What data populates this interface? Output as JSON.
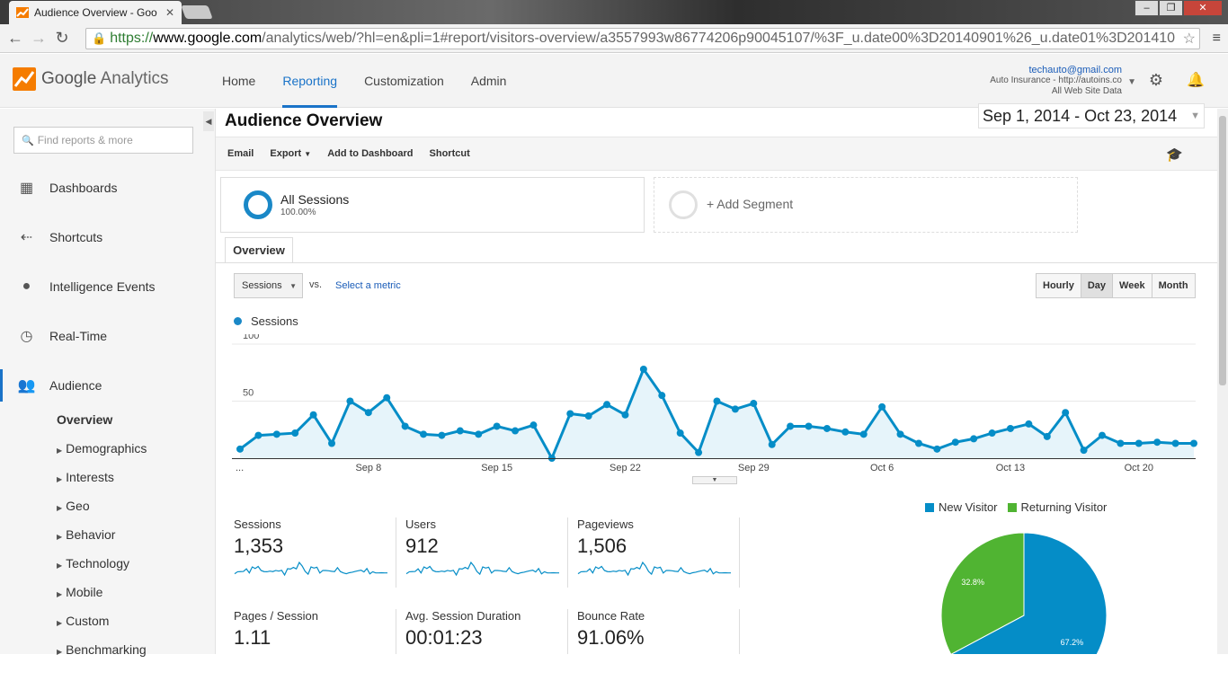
{
  "browser": {
    "tab_title": "Audience Overview - Goo",
    "tab_close": "✕",
    "url_https": "https://",
    "url_domain": "www.google.com",
    "url_path": "/analytics/web/?hl=en&pli=1#report/visitors-overview/a3557993w86774206p90045107/%3F_u.date00%3D20140901%26_u.date01%3D201410",
    "window_buttons": [
      "–",
      "❐",
      "✕"
    ]
  },
  "header": {
    "logo_google": "Google",
    "logo_analytics": "Analytics",
    "nav": [
      "Home",
      "Reporting",
      "Customization",
      "Admin"
    ],
    "active_nav": "Reporting",
    "account_email": "techauto@gmail.com",
    "account_property": "Auto Insurance - http://autoins.co",
    "account_view": "All Web Site Data"
  },
  "sidebar": {
    "search_placeholder": "Find reports & more",
    "items": [
      {
        "label": "Dashboards",
        "icon": "grid-icon"
      },
      {
        "label": "Shortcuts",
        "icon": "arrows-icon"
      },
      {
        "label": "Intelligence Events",
        "icon": "bulb-icon"
      },
      {
        "label": "Real-Time",
        "icon": "clock-icon"
      },
      {
        "label": "Audience",
        "icon": "people-icon"
      }
    ],
    "subitems": [
      "Overview",
      "Demographics",
      "Interests",
      "Geo",
      "Behavior",
      "Technology",
      "Mobile",
      "Custom",
      "Benchmarking"
    ]
  },
  "main": {
    "title": "Audience Overview",
    "date_range": "Sep 1, 2014 - Oct 23, 2014",
    "toolbar": [
      "Email",
      "Export",
      "Add to Dashboard",
      "Shortcut"
    ],
    "segment_name": "All Sessions",
    "segment_pct": "100.00%",
    "add_segment": "+ Add Segment",
    "tab": "Overview",
    "metric_select": "Sessions",
    "vs": "vs.",
    "select_metric": "Select a metric",
    "granularity": [
      "Hourly",
      "Day",
      "Week",
      "Month"
    ],
    "active_granularity": "Day",
    "legend": "Sessions"
  },
  "chart_data": {
    "type": "line",
    "series": [
      {
        "name": "Sessions",
        "values": [
          8,
          20,
          21,
          22,
          38,
          13,
          50,
          40,
          53,
          28,
          21,
          20,
          24,
          21,
          28,
          24,
          29,
          0,
          39,
          37,
          47,
          38,
          78,
          55,
          22,
          5,
          50,
          43,
          48,
          12,
          28,
          28,
          26,
          23,
          21,
          45,
          21,
          13,
          8,
          14,
          17,
          22,
          26,
          30,
          19,
          40,
          7,
          20,
          13,
          13,
          14,
          13,
          13
        ]
      }
    ],
    "x_ticks": [
      "...",
      "Sep 8",
      "Sep 15",
      "Sep 22",
      "Sep 29",
      "Oct 6",
      "Oct 13",
      "Oct 20"
    ],
    "y_ticks": [
      "100",
      "50"
    ],
    "ylim": [
      0,
      100
    ],
    "colors": {
      "line": "#058dc7",
      "fill": "#e6f4fa"
    }
  },
  "metrics": [
    {
      "label": "Sessions",
      "value": "1,353"
    },
    {
      "label": "Users",
      "value": "912"
    },
    {
      "label": "Pageviews",
      "value": "1,506"
    },
    {
      "label": "Pages / Session",
      "value": "1.11"
    },
    {
      "label": "Avg. Session Duration",
      "value": "00:01:23"
    },
    {
      "label": "Bounce Rate",
      "value": "91.06%"
    }
  ],
  "pie": {
    "legend": [
      "New Visitor",
      "Returning Visitor"
    ],
    "values": [
      67.2,
      32.8
    ],
    "labels": [
      "67.2%",
      "32.8%"
    ],
    "colors": [
      "#058dc7",
      "#50b432"
    ]
  }
}
